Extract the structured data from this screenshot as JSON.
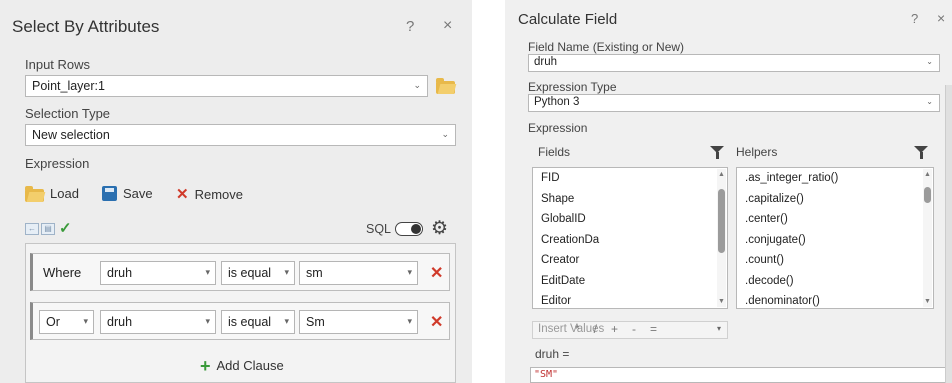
{
  "select_by_attributes": {
    "title": "Select By Attributes",
    "help": "?",
    "close": "×",
    "input_rows_label": "Input Rows",
    "input_rows_value": "Point_layer:1",
    "selection_type_label": "Selection Type",
    "selection_type_value": "New selection",
    "expression_label": "Expression",
    "load_label": "Load",
    "save_label": "Save",
    "remove_label": "Remove",
    "sql_label": "SQL",
    "clauses": [
      {
        "connector": "Where",
        "field": "druh",
        "operator": "is equal",
        "value": "sm"
      },
      {
        "connector": "Or",
        "field": "druh",
        "operator": "is equal",
        "value": "Sm"
      }
    ],
    "add_clause_label": "Add Clause"
  },
  "calculate_field": {
    "title": "Calculate Field",
    "help": "?",
    "close": "×",
    "field_name_label": "Field Name (Existing or New)",
    "field_name_value": "druh",
    "expression_type_label": "Expression Type",
    "expression_type_value": "Python 3",
    "expression_label": "Expression",
    "fields_label": "Fields",
    "helpers_label": "Helpers",
    "fields": [
      "FID",
      "Shape",
      "GlobalID",
      "CreationDa",
      "Creator",
      "EditDate",
      "Editor"
    ],
    "helpers": [
      ".as_integer_ratio()",
      ".capitalize()",
      ".center()",
      ".conjugate()",
      ".count()",
      ".decode()",
      ".denominator()"
    ],
    "insert_values_placeholder": "Insert Values",
    "operators": [
      "*",
      "/",
      "+",
      "-",
      "="
    ],
    "expression_target": "druh =",
    "expression_value": "\"SM\""
  }
}
